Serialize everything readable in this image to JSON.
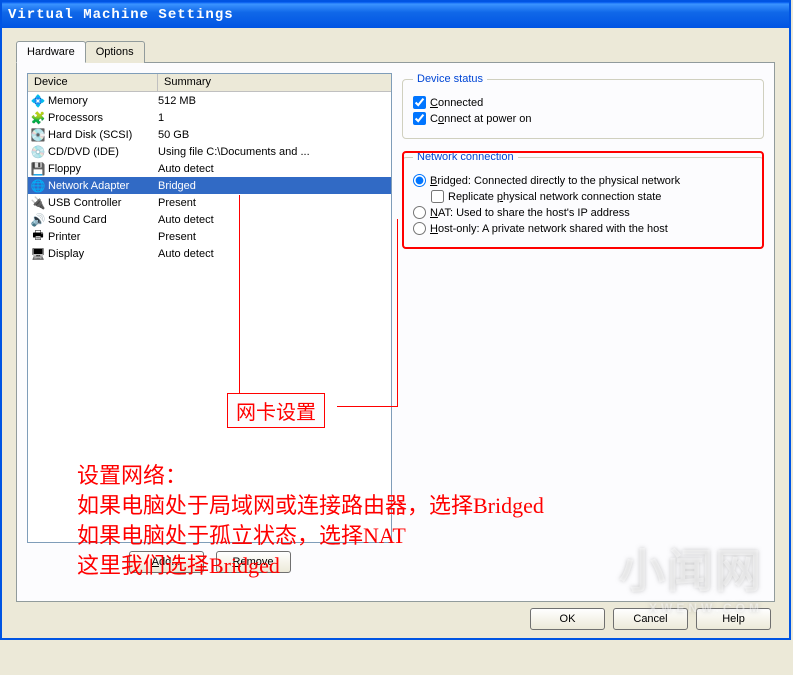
{
  "window": {
    "title": "Virtual Machine Settings"
  },
  "tabs": {
    "hardware": "Hardware",
    "options": "Options",
    "active": "hardware"
  },
  "list": {
    "col_device": "Device",
    "col_summary": "Summary",
    "rows": [
      {
        "icon": "💠",
        "device": "Memory",
        "summary": "512 MB",
        "selected": false
      },
      {
        "icon": "🧩",
        "device": "Processors",
        "summary": "1",
        "selected": false
      },
      {
        "icon": "💽",
        "device": "Hard Disk (SCSI)",
        "summary": "50 GB",
        "selected": false
      },
      {
        "icon": "💿",
        "device": "CD/DVD (IDE)",
        "summary": "Using file C:\\Documents and ...",
        "selected": false
      },
      {
        "icon": "💾",
        "device": "Floppy",
        "summary": "Auto detect",
        "selected": false
      },
      {
        "icon": "🌐",
        "device": "Network Adapter",
        "summary": "Bridged",
        "selected": true
      },
      {
        "icon": "🔌",
        "device": "USB Controller",
        "summary": "Present",
        "selected": false
      },
      {
        "icon": "🔊",
        "device": "Sound Card",
        "summary": "Auto detect",
        "selected": false
      },
      {
        "icon": "🖶",
        "device": "Printer",
        "summary": "Present",
        "selected": false
      },
      {
        "icon": "🖥",
        "device": "Display",
        "summary": "Auto detect",
        "selected": false
      }
    ],
    "add_btn": "Add...",
    "remove_btn": "Remove"
  },
  "device_status": {
    "legend": "Device status",
    "connected": {
      "label": "Connected",
      "checked": true
    },
    "connect_at_power_on": {
      "label": "Connect at power on",
      "checked": true
    }
  },
  "network_connection": {
    "legend": "Network connection",
    "bridged": {
      "label": "Bridged: Connected directly to the physical network",
      "selected": true
    },
    "replicate": {
      "label": "Replicate physical network connection state",
      "checked": false
    },
    "nat": {
      "label": "NAT: Used to share the host's IP address",
      "selected": false
    },
    "hostonly": {
      "label": "Host-only: A private network shared with the host",
      "selected": false
    }
  },
  "bottom": {
    "ok": "OK",
    "cancel": "Cancel",
    "help": "Help"
  },
  "annotations": {
    "label_box": "网卡设置",
    "body": "设置网络：\n如果电脑处于局域网或连接路由器，选择Bridged\n如果电脑处于孤立状态，选择NAT\n这里我们选择Bridged"
  },
  "watermark": {
    "main": "小闻网",
    "sub": "XWENW.COM"
  }
}
